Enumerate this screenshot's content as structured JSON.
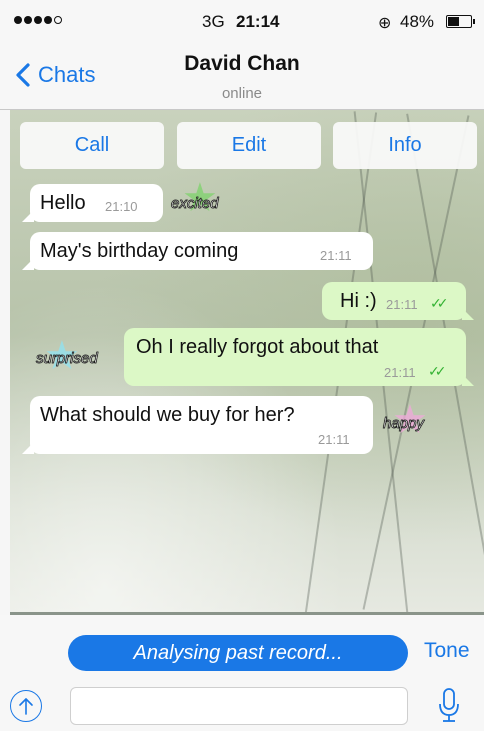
{
  "status_bar": {
    "network": "3G",
    "time": "21:14",
    "battery": "48%",
    "battery_level": 0.48
  },
  "header": {
    "back_label": "Chats",
    "contact_name": "David Chan",
    "contact_status": "online"
  },
  "actions": {
    "call": "Call",
    "edit": "Edit",
    "info": "Info"
  },
  "messages": [
    {
      "direction": "in",
      "text": "Hello",
      "time": "21:10",
      "mood": "excited",
      "mood_color": "#7ed36b"
    },
    {
      "direction": "in",
      "text": "May's birthday coming",
      "time": "21:11"
    },
    {
      "direction": "out",
      "text": "Hi :)",
      "time": "21:11",
      "ticks": "✓✓"
    },
    {
      "direction": "out",
      "text": "Oh I really forgot about that",
      "time": "21:11",
      "ticks": "✓✓",
      "mood": "surprised",
      "mood_color": "#8fe3f2"
    },
    {
      "direction": "in",
      "text": "What should we buy for her?",
      "time": "21:11",
      "mood": "happy",
      "mood_color": "#f2a8dc"
    }
  ],
  "footer": {
    "analysis_text": "Analysing past record...",
    "tone_label": "Tone",
    "input_value": "",
    "input_placeholder": ""
  },
  "colors": {
    "accent": "#1a78e6",
    "outgoing_bubble": "#dcf8c6",
    "incoming_bubble": "#ffffff",
    "read_ticks": "#34b233"
  },
  "icons": {
    "back": "chevron-left-icon",
    "lock": "rotation-lock-icon",
    "attach": "arrow-up-circle-icon",
    "mic": "microphone-icon"
  }
}
